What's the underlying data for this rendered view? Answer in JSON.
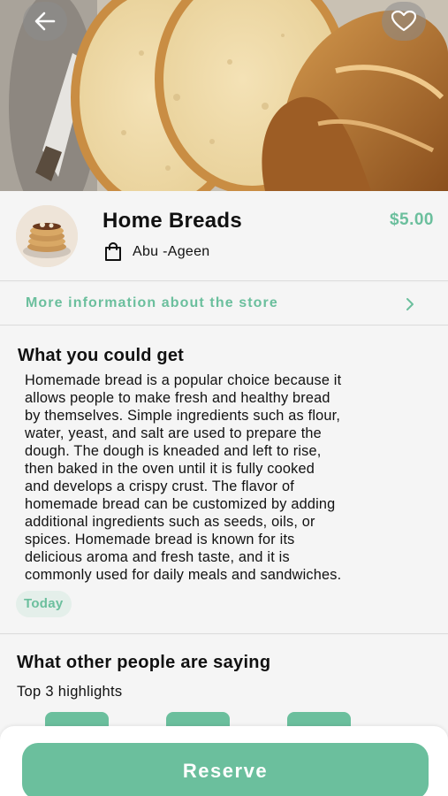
{
  "hero": {
    "back_icon": "arrow-left-icon",
    "favorite_icon": "heart-icon"
  },
  "store": {
    "title": "Home Breads",
    "price": "$5.00",
    "owner_icon": "shopping-bag-icon",
    "owner": "Abu -Ageen"
  },
  "more_info": {
    "label": "More information about the store",
    "icon": "chevron-right-icon"
  },
  "what_you_get": {
    "title": "What you could get",
    "description_lines": [
      "Homemade bread is a popular choice because it",
      "allows people to make fresh and healthy bread",
      "by themselves. Simple ingredients such as flour,",
      "water, yeast, and salt are used to prepare the",
      "dough. The dough is kneaded and left to rise,",
      "then baked in the oven until it is fully cooked",
      "and develops a crispy crust. The flavor of",
      "homemade bread can be customized by adding",
      "additional ingredients such as seeds, oils, or",
      "spices. Homemade bread is known for its",
      "delicious aroma and fresh taste, and it is",
      "commonly used for daily meals and sandwiches."
    ],
    "chip": "Today"
  },
  "reviews": {
    "title": "What other people are saying",
    "subtitle": "Top 3 highlights"
  },
  "footer": {
    "reserve_label": "Reserve"
  },
  "colors": {
    "accent": "#6bbf9d",
    "background": "#f5f5f5"
  }
}
